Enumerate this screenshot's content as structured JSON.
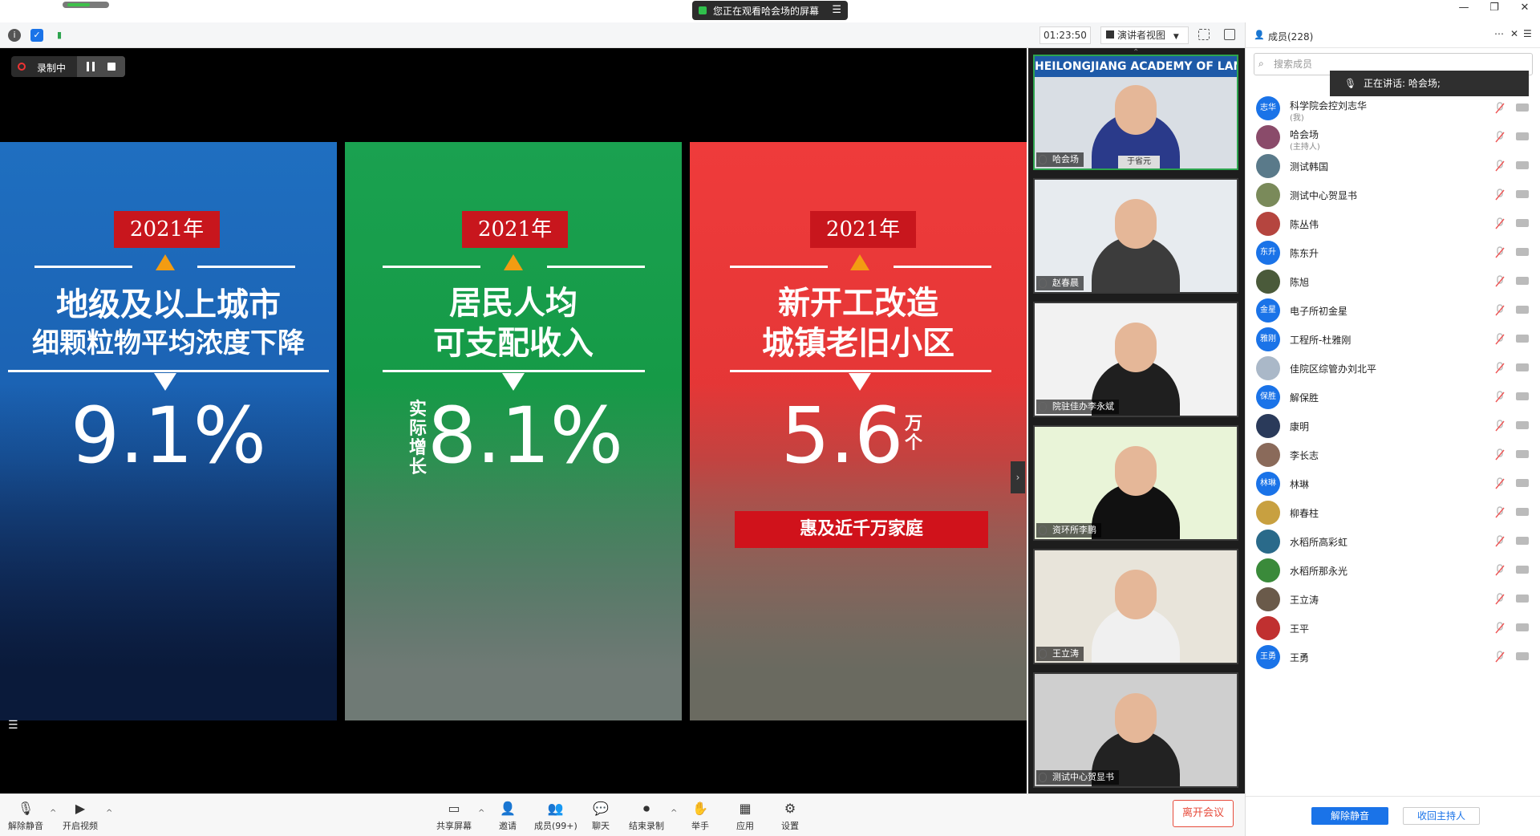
{
  "share_banner": "您正在观看哈会场的屏幕",
  "toolbar": {
    "timer": "01:23:50",
    "view_mode": "演讲者视图"
  },
  "recording": {
    "label": "录制中"
  },
  "slides": [
    {
      "year": "2021年",
      "line1": "地级及以上城市",
      "line2": "细颗粒物平均浓度下降",
      "value": "9.1%",
      "side": "",
      "banner": "",
      "color": "#1f6fc0"
    },
    {
      "year": "2021年",
      "line1": "居民人均",
      "line2": "可支配收入",
      "value": "8.1%",
      "side": "实际增长",
      "banner": "",
      "color": "#1aa150"
    },
    {
      "year": "2021年",
      "line1": "新开工改造",
      "line2": "城镇老旧小区",
      "value": "5.6",
      "side": "万个",
      "banner": "惠及近千万家庭",
      "color": "#ef3b3b"
    }
  ],
  "video_tiles": [
    {
      "name": "哈会场",
      "nameplate": "于省元",
      "banner": "HEILONGJIANG ACADEMY OF LAND RE"
    },
    {
      "name": "赵春晨"
    },
    {
      "name": "院驻佳办李永斌"
    },
    {
      "name": "资环所李鹏"
    },
    {
      "name": "王立涛"
    },
    {
      "name": "测试中心贺显书"
    }
  ],
  "bottom": {
    "unmute": "解除静音",
    "video": "开启视频",
    "share": "共享屏幕",
    "invite": "邀请",
    "members": "成员(99+)",
    "chat": "聊天",
    "end_record": "结束录制",
    "raise_hand": "举手",
    "apps": "应用",
    "settings": "设置",
    "leave": "离开会议"
  },
  "sidebar": {
    "title": "成员(228)",
    "search_placeholder": "搜索成员",
    "speaking": "正在讲话: 哈会场;",
    "unmute_all": "解除静音",
    "reclaim_host": "收回主持人",
    "members": [
      {
        "name": "科学院会控刘志华",
        "sub": "(我)",
        "avatar": "志华",
        "color": "#1a73e8"
      },
      {
        "name": "哈会场",
        "sub": "(主持人)",
        "avatar": "",
        "color": "#8a4b6a"
      },
      {
        "name": "测试韩国",
        "sub": "",
        "avatar": "",
        "color": "#5a7a8a"
      },
      {
        "name": "测试中心贺显书",
        "sub": "",
        "avatar": "",
        "color": "#7a8a5a"
      },
      {
        "name": "陈丛伟",
        "sub": "",
        "avatar": "",
        "color": "#b5453f"
      },
      {
        "name": "陈东升",
        "sub": "",
        "avatar": "东升",
        "color": "#1a73e8"
      },
      {
        "name": "陈旭",
        "sub": "",
        "avatar": "",
        "color": "#4a5a3a"
      },
      {
        "name": "电子所初金星",
        "sub": "",
        "avatar": "金星",
        "color": "#1a73e8"
      },
      {
        "name": "工程所-杜雅刚",
        "sub": "",
        "avatar": "雅刚",
        "color": "#1a73e8"
      },
      {
        "name": "佳院区综管办刘北平",
        "sub": "",
        "avatar": "",
        "color": "#aab8c8"
      },
      {
        "name": "解保胜",
        "sub": "",
        "avatar": "保胜",
        "color": "#1a73e8"
      },
      {
        "name": "康明",
        "sub": "",
        "avatar": "",
        "color": "#2a3a5a"
      },
      {
        "name": "李长志",
        "sub": "",
        "avatar": "",
        "color": "#8a6a5a"
      },
      {
        "name": "林琳",
        "sub": "",
        "avatar": "林琳",
        "color": "#1a73e8"
      },
      {
        "name": "柳春柱",
        "sub": "",
        "avatar": "",
        "color": "#c8a040"
      },
      {
        "name": "水稻所高彩虹",
        "sub": "",
        "avatar": "",
        "color": "#2a6a8a"
      },
      {
        "name": "水稻所那永光",
        "sub": "",
        "avatar": "",
        "color": "#3a8a3a"
      },
      {
        "name": "王立涛",
        "sub": "",
        "avatar": "",
        "color": "#6a5a4a"
      },
      {
        "name": "王平",
        "sub": "",
        "avatar": "",
        "color": "#c03030"
      },
      {
        "name": "王勇",
        "sub": "",
        "avatar": "王勇",
        "color": "#1a73e8"
      }
    ]
  }
}
